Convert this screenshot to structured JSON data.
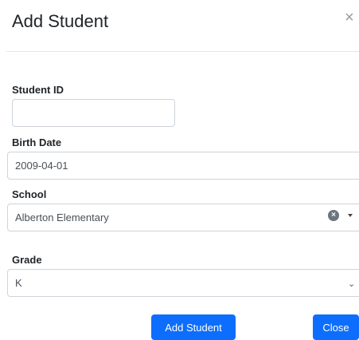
{
  "modal": {
    "title": "Add Student",
    "close_glyph": "×"
  },
  "form": {
    "student_id": {
      "label": "Student ID",
      "value": ""
    },
    "birth_date": {
      "label": "Birth Date",
      "value": "2009-04-01"
    },
    "school": {
      "label": "School",
      "value": "Alberton Elementary",
      "clear_glyph": "×"
    },
    "grade": {
      "label": "Grade",
      "value": "K",
      "chevron_glyph": "⌄"
    }
  },
  "buttons": {
    "add_student": "Add Student",
    "close": "Close"
  },
  "colors": {
    "primary_button": "#0d6efd",
    "clear_badge": "#6c757d",
    "field_border": "#ced4da"
  },
  "icons": {
    "close": "close-icon",
    "clear": "clear-icon",
    "dropdown": "caret-down-icon",
    "select_chevron": "chevron-down-icon"
  }
}
